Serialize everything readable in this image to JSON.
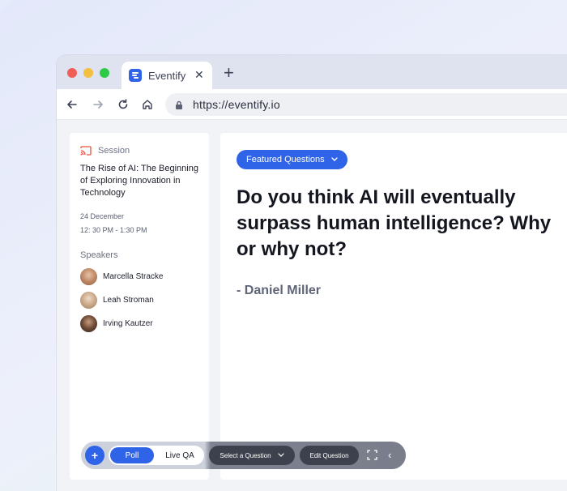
{
  "browser": {
    "tab_title": "Eventify",
    "tab_close": "✕",
    "new_tab": "+",
    "url": "https://eventify.io"
  },
  "sidebar": {
    "session_label": "Session",
    "session_title": "The Rise of AI: The Beginning of Exploring Innovation in Technology",
    "date": "24 December",
    "time": "12: 30 PM - 1:30 PM",
    "speakers_heading": "Speakers",
    "speakers": [
      {
        "name": "Marcella Stracke"
      },
      {
        "name": "Leah Stroman"
      },
      {
        "name": "Irving Kautzer"
      }
    ]
  },
  "main": {
    "featured_button": "Featured Questions",
    "question": "Do you think AI will eventually surpass human intelligence? Why or why not?",
    "author": "- Daniel Miller"
  },
  "controls": {
    "add": "+",
    "poll": "Poll",
    "live_qa": "Live QA",
    "select_question": "Select a Question",
    "edit_question": "Edit Question",
    "collapse": "‹"
  },
  "colors": {
    "accent": "#2f63e8",
    "session_icon": "#e8503a",
    "dark_pill": "#3d414d"
  }
}
